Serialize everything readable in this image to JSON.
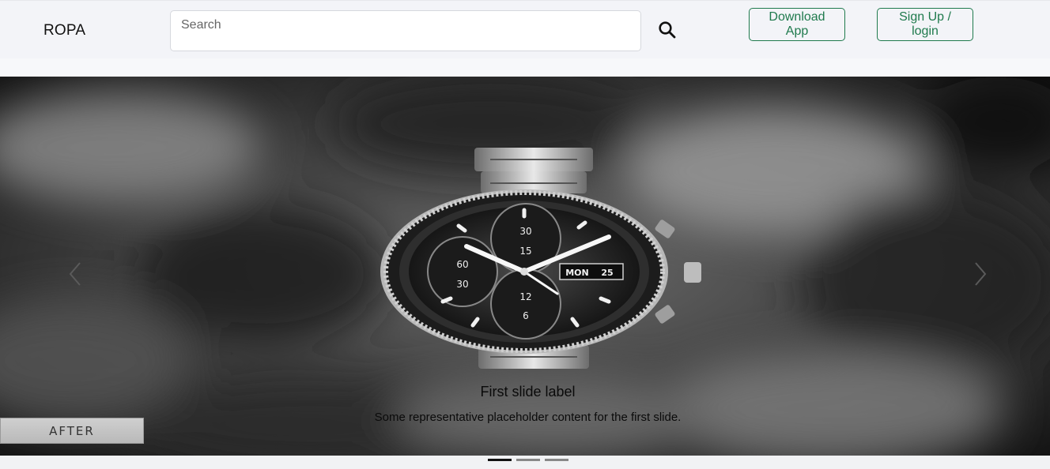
{
  "header": {
    "brand": "ROPA",
    "search": {
      "placeholder": "Search",
      "value": ""
    },
    "download_label": "Download App",
    "signup_label": "Sign Up / login"
  },
  "carousel": {
    "slides_count": 3,
    "active_index": 0,
    "caption_title": "First slide label",
    "caption_text": "Some representative placeholder content for the first slide.",
    "badge_text": "AFTER",
    "watch": {
      "subdial_top": "30",
      "subdial_top_inner": "15",
      "subdial_left": "60",
      "subdial_left_inner": "30",
      "subdial_bottom": "12",
      "subdial_bottom_inner": "6",
      "day": "MON",
      "date": "25"
    }
  },
  "icons": {
    "search": "search-icon",
    "prev": "chevron-left-icon",
    "next": "chevron-right-icon"
  },
  "colors": {
    "header_bg": "#f3f4f8",
    "accent": "#1f7a4d"
  }
}
